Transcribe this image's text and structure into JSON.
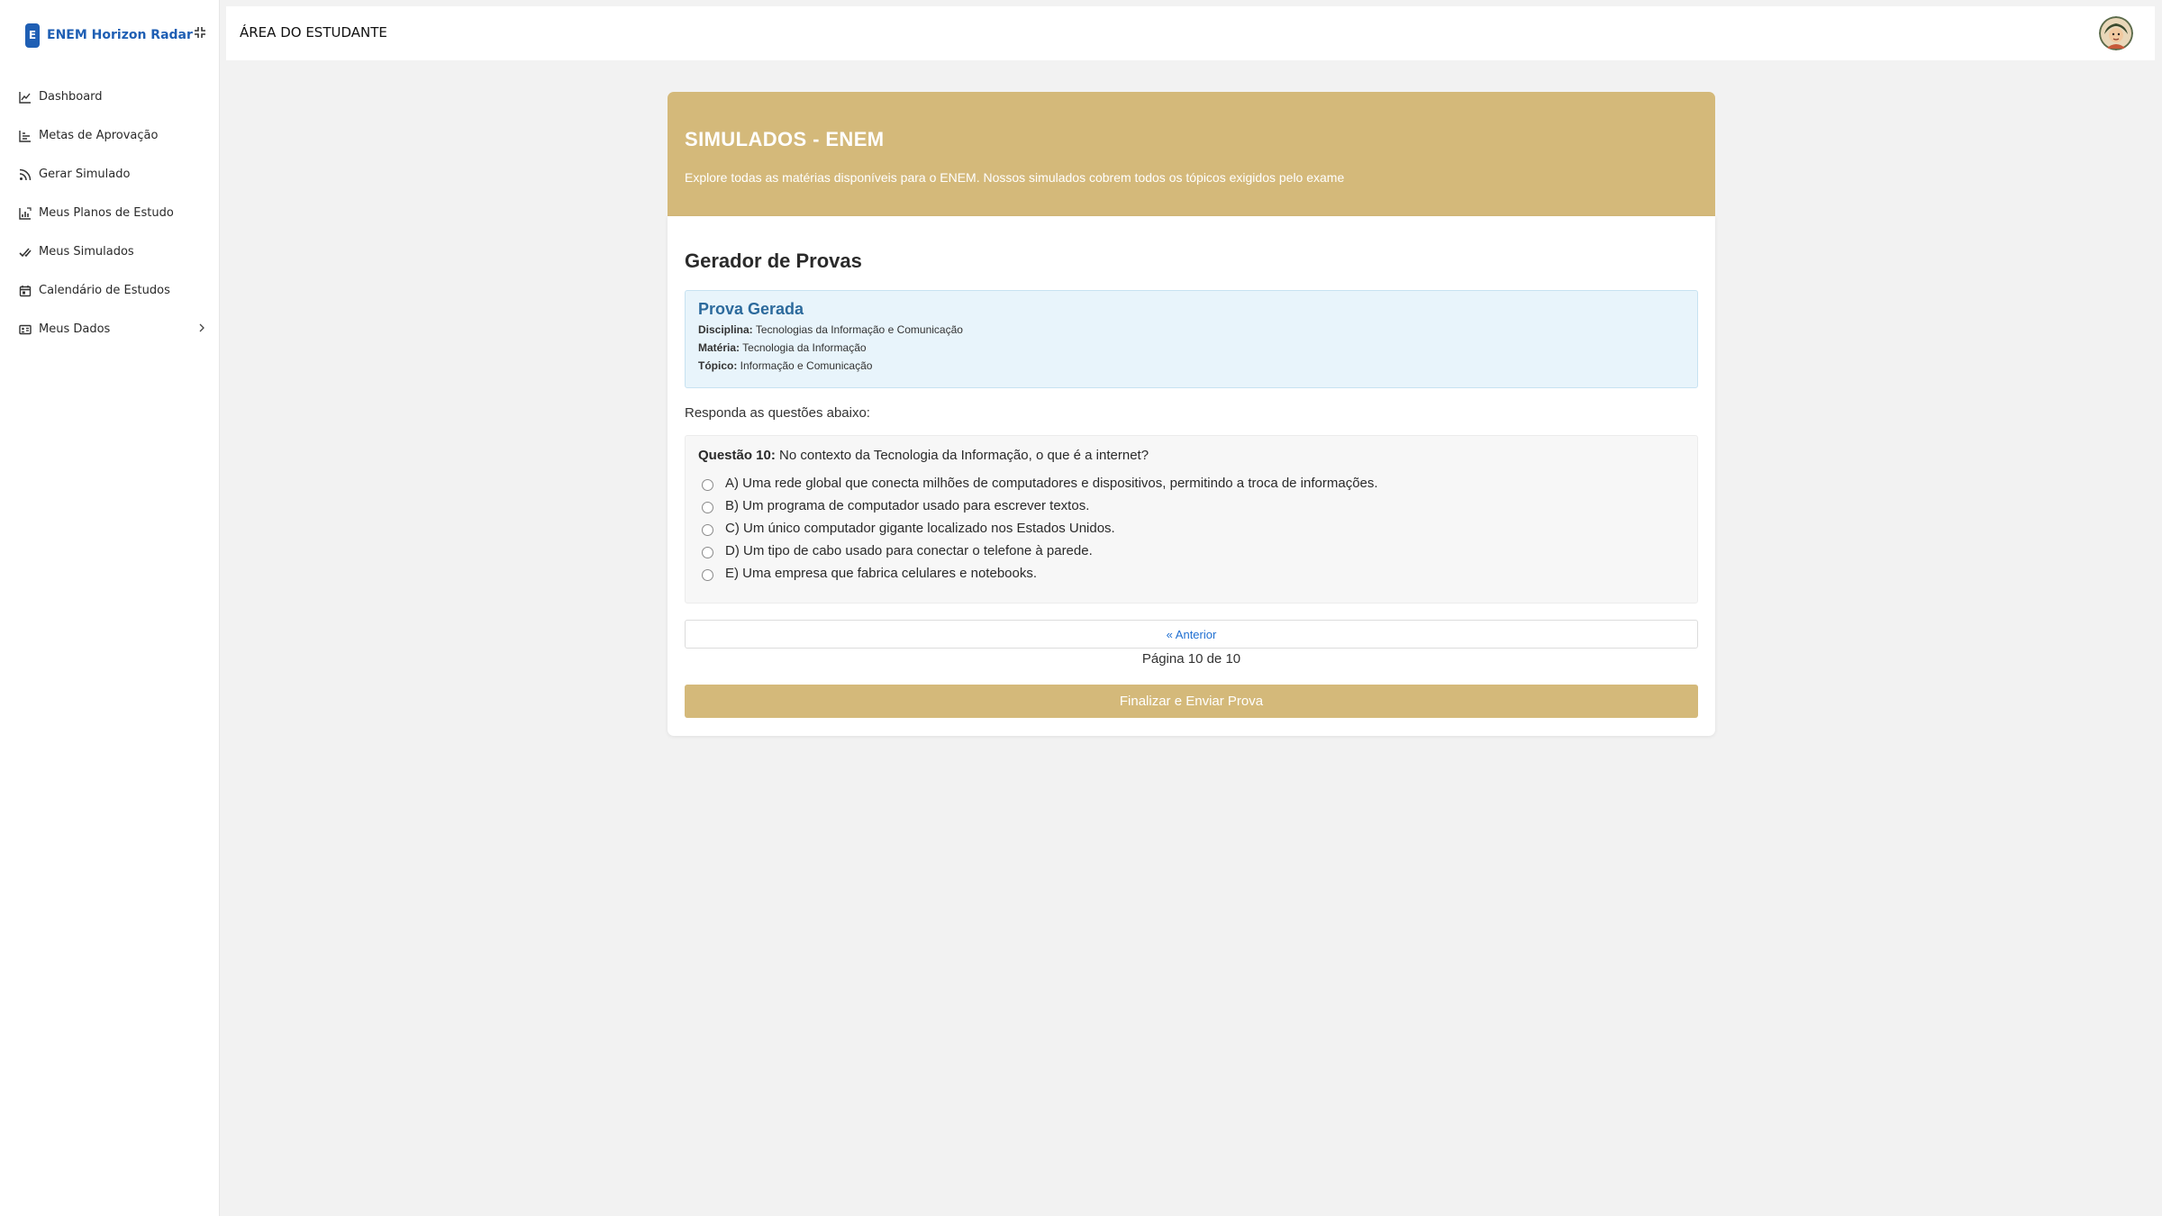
{
  "app": {
    "brand_badge": "E",
    "brand_name": "ENEM Horizon Radar",
    "collapse_icon": "collapse-icon"
  },
  "sidebar": {
    "items": [
      {
        "label": "Dashboard",
        "icon": "line-chart-icon"
      },
      {
        "label": "Metas de Aprovação",
        "icon": "bar-chart-icon"
      },
      {
        "label": "Gerar Simulado",
        "icon": "rss-icon"
      },
      {
        "label": "Meus Planos de Estudo",
        "icon": "plan-chart-icon"
      },
      {
        "label": "Meus Simulados",
        "icon": "double-check-icon"
      },
      {
        "label": "Calendário de Estudos",
        "icon": "calendar-icon"
      },
      {
        "label": "Meus Dados",
        "icon": "id-card-icon",
        "has_submenu": true
      }
    ]
  },
  "header": {
    "title": "ÁREA DO ESTUDANTE",
    "avatar_icon": "user-avatar-icon"
  },
  "hero": {
    "title": "SIMULADOS - ENEM",
    "subtitle": "Explore todas as matérias disponíveis para o ENEM. Nossos simulados cobrem todos os tópicos exigidos pelo exame"
  },
  "exam": {
    "title": "Gerador de Provas",
    "info": {
      "title": "Prova Gerada",
      "disciplina_label": "Disciplina:",
      "disciplina": "Tecnologias da Informação e Comunicação",
      "materia_label": "Matéria:",
      "materia": "Tecnologia da Informação",
      "topico_label": "Tópico:",
      "topico": "Informação e Comunicação"
    },
    "instructions": "Responda as questões abaixo:",
    "question": {
      "number_label": "Questão 10:",
      "text": "No contexto da Tecnologia da Informação, o que é a internet?",
      "options": [
        "A) Uma rede global que conecta milhões de computadores e dispositivos, permitindo a troca de informações.",
        "B) Um programa de computador usado para escrever textos.",
        "C) Um único computador gigante localizado nos Estados Unidos.",
        "D) Um tipo de cabo usado para conectar o telefone à parede.",
        "E) Uma empresa que fabrica celulares e notebooks."
      ]
    },
    "prev_label": "« Anterior",
    "page_indicator": "Página 10 de 10",
    "submit_label": "Finalizar e Enviar Prova"
  },
  "colors": {
    "accent": "#d4b97a",
    "brand": "#1f5fb4",
    "info_bg": "#e8f4fb",
    "info_title": "#2c6a9c",
    "link": "#1f6fd1"
  }
}
